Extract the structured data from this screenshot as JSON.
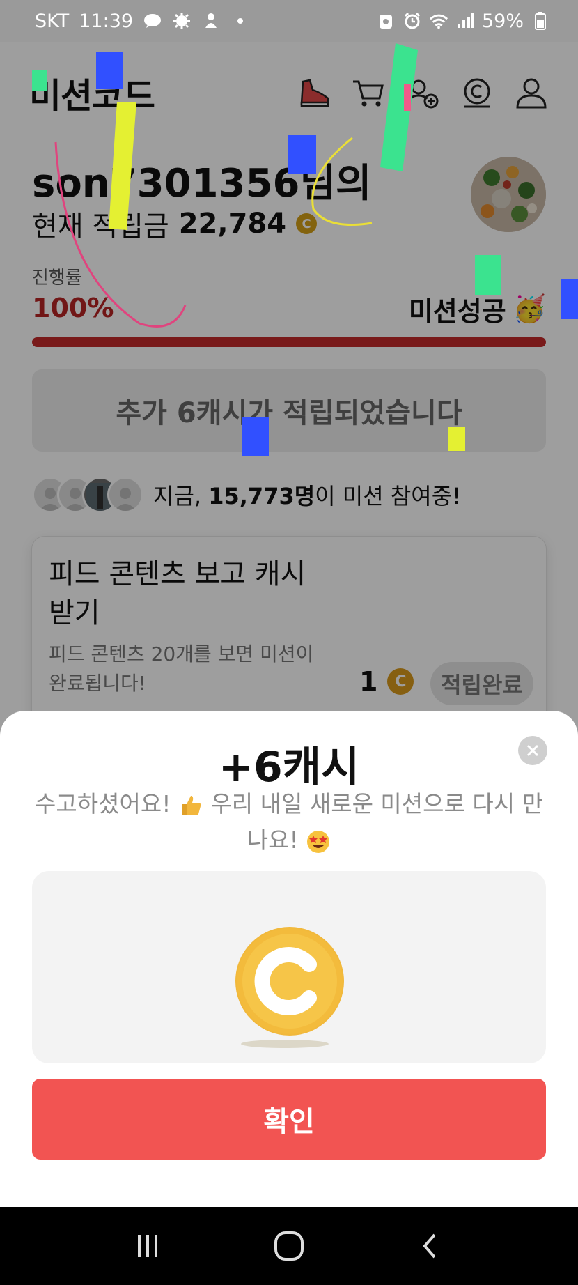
{
  "status_bar": {
    "carrier": "SKT",
    "time": "11:39",
    "battery": "59%"
  },
  "header": {
    "logo": "미션코드"
  },
  "profile": {
    "greeting": "son7301356님의",
    "points_label": "현재 적립금",
    "points_value": "22,784",
    "coin_symbol": "C"
  },
  "progress": {
    "label": "진행률",
    "percent_text": "100%",
    "fill_fraction": 1.0,
    "status": "미션성공",
    "status_emoji": "🥳"
  },
  "banner": {
    "text": "추가 6캐시가 적립되었습니다"
  },
  "participants": {
    "prefix": "지금, ",
    "count": "15,773명",
    "suffix": "이 미션 참여중!"
  },
  "task": {
    "title": "피드 콘텐츠 보고 캐시 받기",
    "description": "피드 콘텐츠 20개를 보면 미션이 완료됩니다!",
    "reward": "1",
    "button_label": "적립완료"
  },
  "sheet": {
    "title": "+6캐시",
    "message_part1": "수고하셨어요!",
    "message_part2": " 우리 내일 새로운 미션으로 다시 만나요!",
    "confirm_label": "확인"
  },
  "colors": {
    "accent_red": "#f25452",
    "progress_red": "#c42a2a",
    "coin_gold": "#f1b83b"
  }
}
